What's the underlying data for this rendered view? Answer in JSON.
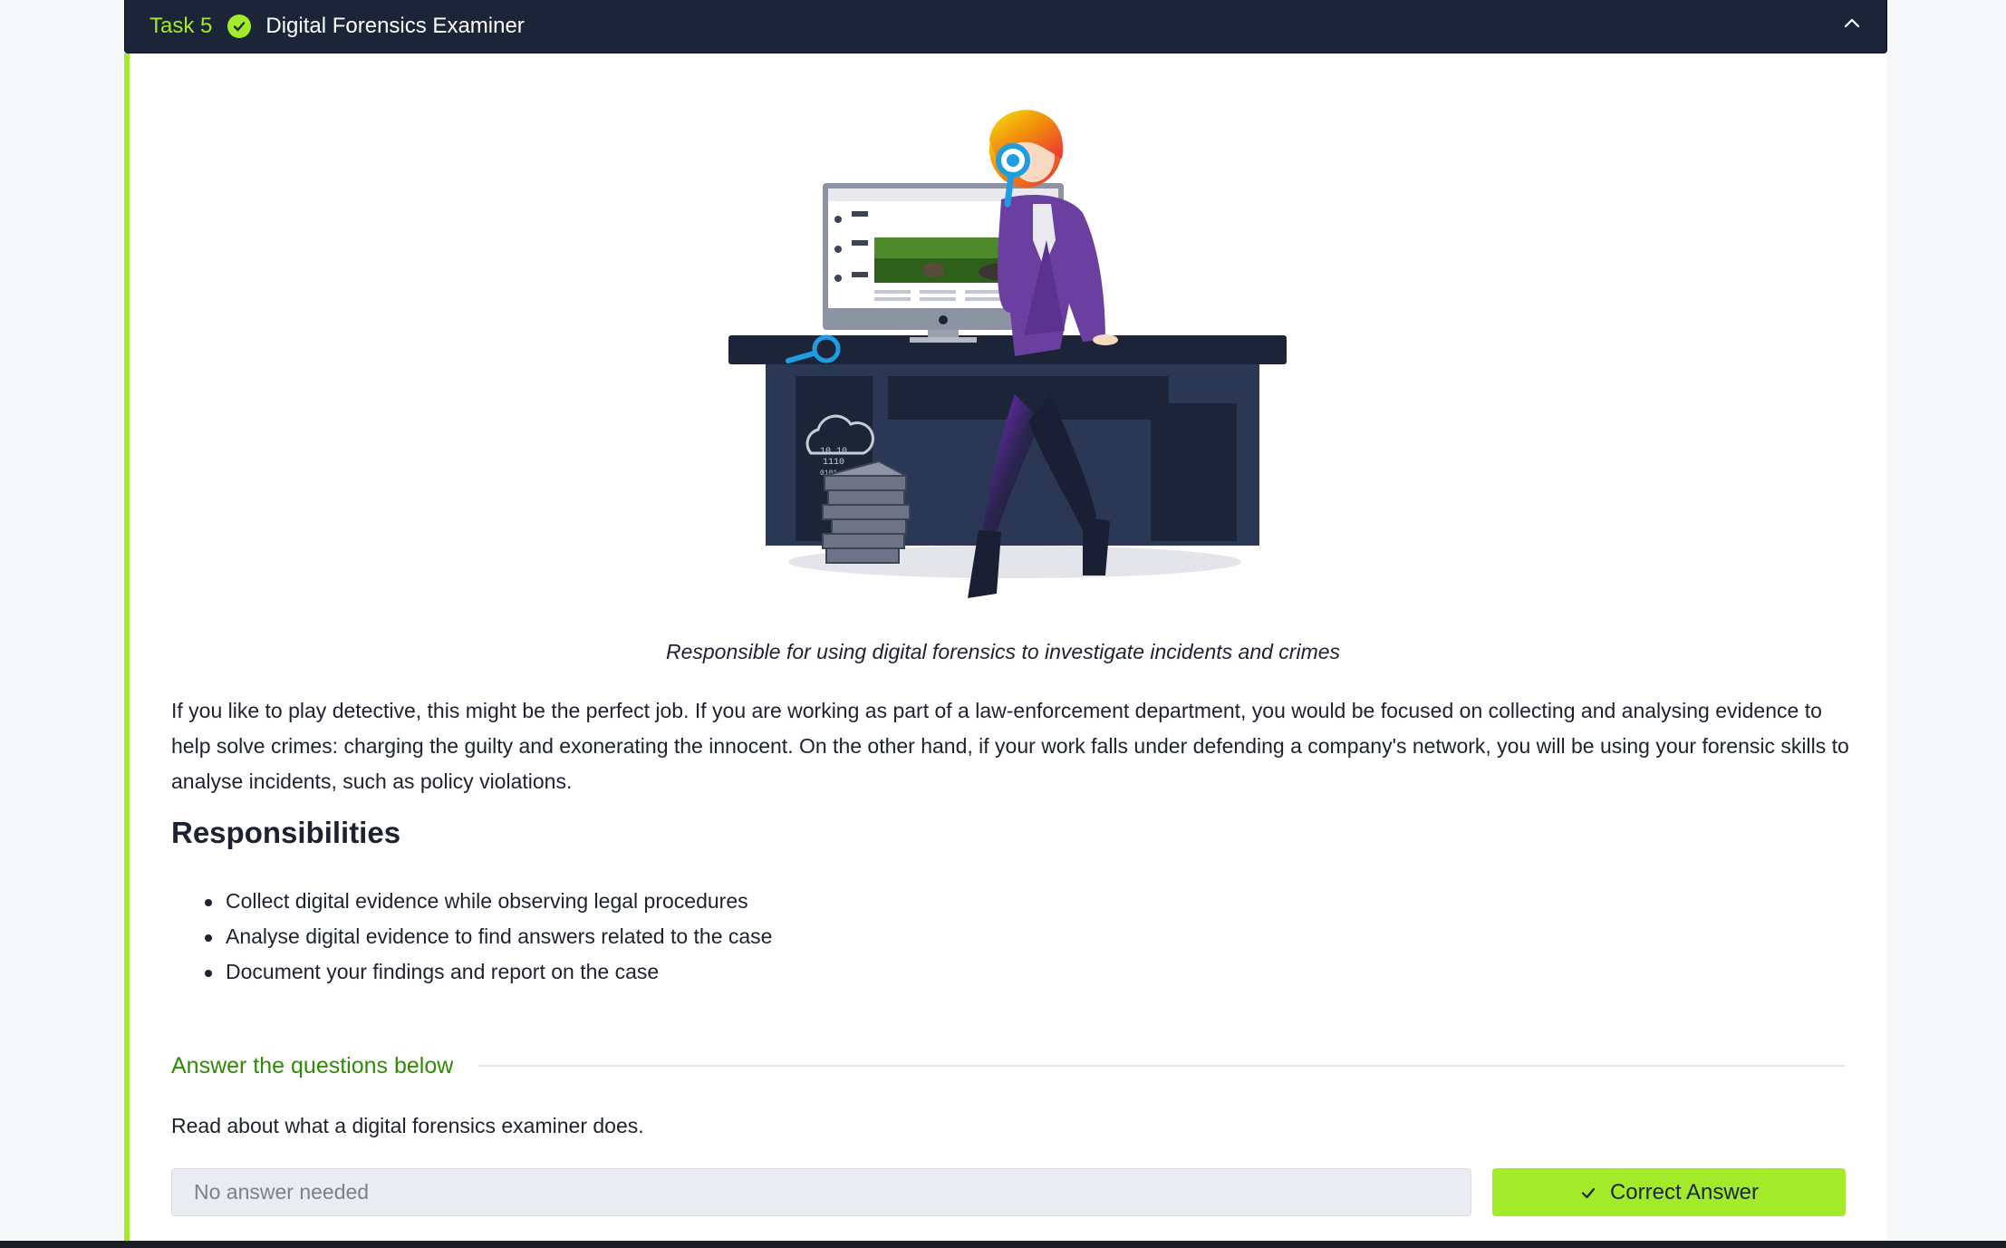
{
  "task": {
    "number_label": "Task 5",
    "status_icon": "check-circle-icon",
    "title": "Digital Forensics Examiner",
    "collapse_icon": "chevron-up-icon",
    "accent_color": "#a3ea2a",
    "header_color": "#1c2538"
  },
  "content": {
    "caption": "Responsible for using digital forensics to investigate incidents and crimes",
    "paragraph": "If you like to play detective, this might be the perfect job. If you are working as part of a law-enforcement department, you would be focused on collecting and analysing evidence to help solve crimes: charging the guilty and exonerating the innocent. On the other hand, if your work falls under defending a company's network, you will be using your forensic skills to analyse incidents, such as policy violations.",
    "responsibilities_heading": "Responsibilities",
    "responsibilities": [
      "Collect digital evidence while observing legal procedures",
      "Analyse digital evidence to find answers related to the case",
      "Document your findings and report on the case"
    ],
    "illustration_code_lines": [
      "10 10",
      "1110",
      "0101 01"
    ]
  },
  "questions": {
    "section_label": "Answer the questions below",
    "items": [
      {
        "text": "Read about what a digital forensics examiner does.",
        "placeholder": "No answer needed",
        "button_label": "Correct Answer",
        "button_icon": "check-icon"
      }
    ]
  }
}
